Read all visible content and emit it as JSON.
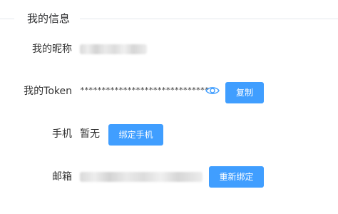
{
  "section": {
    "title": "我的信息"
  },
  "nickname": {
    "label": "我的昵称"
  },
  "token": {
    "label": "我的Token",
    "masked_value": "******************************",
    "copy_label": "复制"
  },
  "phone": {
    "label": "手机",
    "value": "暂无",
    "bind_label": "绑定手机"
  },
  "email": {
    "label": "邮箱",
    "rebind_label": "重新绑定"
  },
  "colors": {
    "primary": "#409eff",
    "text": "#333333",
    "divider": "#e4e7ed",
    "icon": "#409eff"
  }
}
